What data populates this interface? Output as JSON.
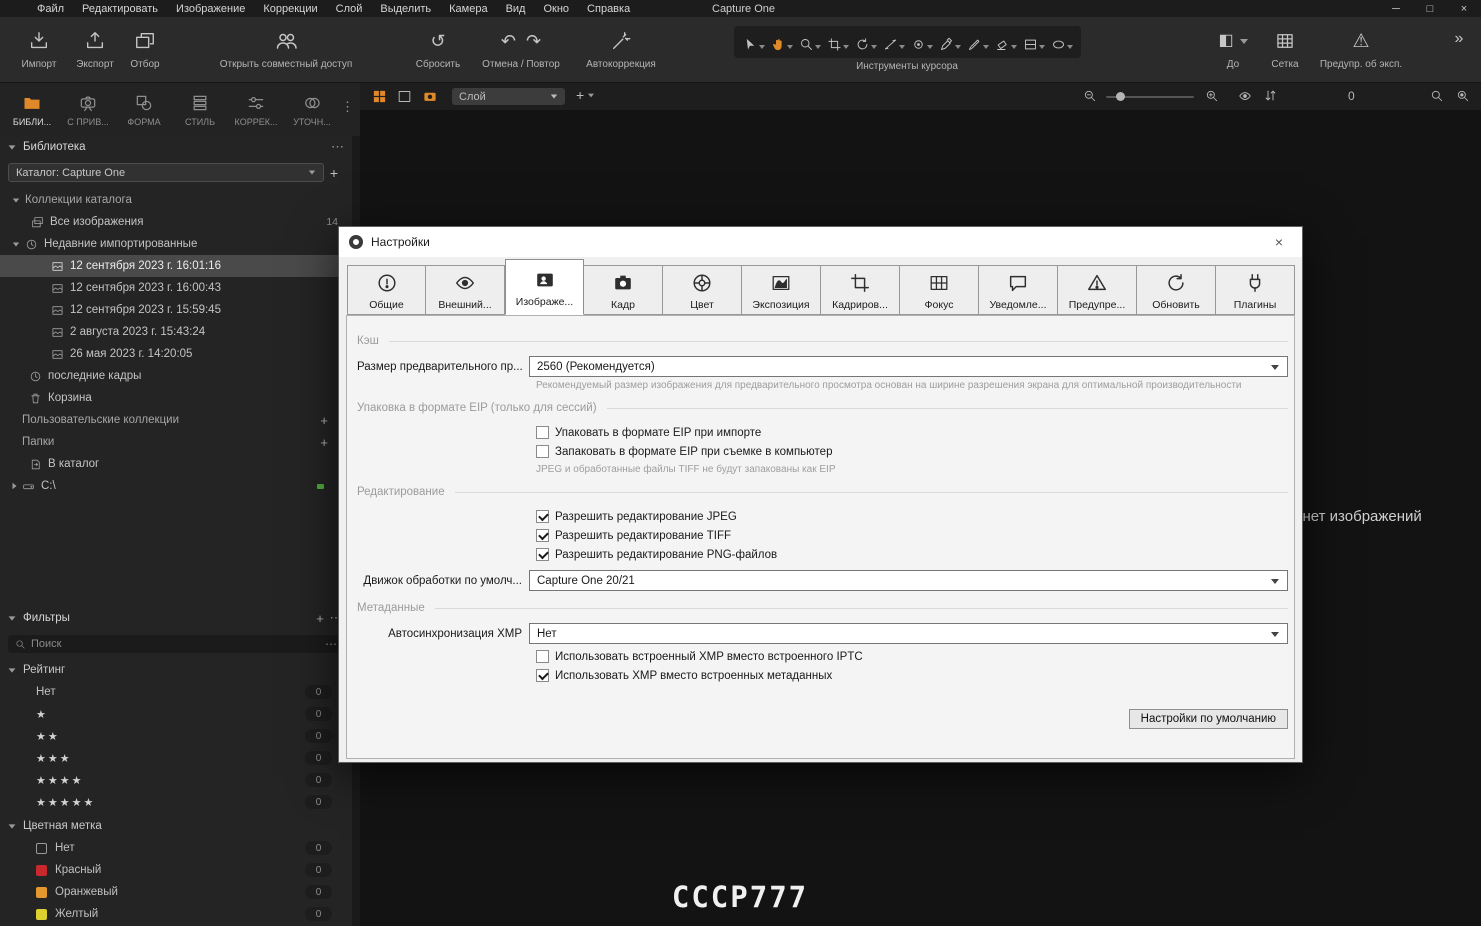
{
  "window": {
    "app_title": "Capture One",
    "controls": {
      "minimize": "─",
      "maximize": "□",
      "close": "×"
    }
  },
  "icons": {
    "plus": "+",
    "more": "⋯",
    "vertical_dots": "⋮",
    "overflow": "»",
    "undo": "↶",
    "redo": "↷",
    "reset": "↺",
    "warning": "⚠",
    "before": "◧"
  },
  "menubar": [
    "Файл",
    "Редактировать",
    "Изображение",
    "Коррекции",
    "Слой",
    "Выделить",
    "Камера",
    "Вид",
    "Окно",
    "Справка"
  ],
  "toolbar": {
    "import_label": "Импорт",
    "export_label": "Экспорт",
    "cull_label": "Отбор",
    "share_label": "Открыть совместный доступ",
    "reset_label": "Сбросить",
    "undo_redo_label": "Отмена / Повтор",
    "autocorrect_label": "Автокоррекция",
    "cursor_tools_label": "Инструменты курсора",
    "before_label": "До",
    "grid_label": "Сетка",
    "exposure_warning_label": "Предупр. об эксп."
  },
  "tool_tabs": [
    {
      "label": "БИБЛИ..."
    },
    {
      "label": "С ПРИВ..."
    },
    {
      "label": "ФОРМА"
    },
    {
      "label": "СТИЛЬ"
    },
    {
      "label": "КОРРЕК..."
    },
    {
      "label": "УТОЧН..."
    }
  ],
  "library": {
    "panel_title": "Библиотека",
    "catalog_selector": "Каталог: Capture One",
    "groups": {
      "catalog_collections": "Коллекции каталога",
      "user_collections": "Пользовательские коллекции",
      "folders": "Папки"
    },
    "items": {
      "all_images": {
        "label": "Все изображения",
        "count": "14"
      },
      "recent_imports": "Недавние импортированные",
      "recent_captures": "последние кадры",
      "trash": "Корзина",
      "in_catalog": "В каталог",
      "drive_c": "C:\\"
    },
    "import_sessions": [
      "12 сентября 2023 г. 16:01:16",
      "12 сентября 2023 г. 16:00:43",
      "12 сентября 2023 г. 15:59:45",
      "2 августа 2023 г. 15:43:24",
      "26 мая 2023 г. 14:20:05"
    ]
  },
  "filters": {
    "panel_title": "Фильтры",
    "search_placeholder": "Поиск",
    "rating_group_label": "Рейтинг",
    "ratings": [
      {
        "label": "Нет",
        "count": "0"
      },
      {
        "label": "★",
        "count": "0"
      },
      {
        "label": "★★",
        "count": "0"
      },
      {
        "label": "★★★",
        "count": "0"
      },
      {
        "label": "★★★★",
        "count": "0"
      },
      {
        "label": "★★★★★",
        "count": "0"
      }
    ],
    "color_group_label": "Цветная метка",
    "color_labels": [
      {
        "label": "Нет",
        "count": "0",
        "swatch": "none"
      },
      {
        "label": "Красный",
        "count": "0",
        "swatch": "#c9282d"
      },
      {
        "label": "Оранжевый",
        "count": "0",
        "swatch": "#e2972f"
      },
      {
        "label": "Желтый",
        "count": "0",
        "swatch": "#ddd12f"
      }
    ]
  },
  "viewer": {
    "layer_selector": "Слой",
    "edit_counter": "0",
    "empty_message": "е нет изображений",
    "photo_plate_text": "СССР777"
  },
  "dialog": {
    "title": "Настройки",
    "tabs": [
      {
        "label": "Общие"
      },
      {
        "label": "Внешний..."
      },
      {
        "label": "Изображе..."
      },
      {
        "label": "Кадр"
      },
      {
        "label": "Цвет"
      },
      {
        "label": "Экспозиция"
      },
      {
        "label": "Кадриров..."
      },
      {
        "label": "Фокус"
      },
      {
        "label": "Уведомле..."
      },
      {
        "label": "Предупре..."
      },
      {
        "label": "Обновить"
      },
      {
        "label": "Плагины"
      }
    ],
    "cache_section": "Кэш",
    "preview_size_label": "Размер предварительного пр...",
    "preview_size_value": "2560 (Рекомендуется)",
    "preview_size_help": "Рекомендуемый размер изображения для предварительного просмотра основан на ширине разрешения экрана для оптимальной производительности",
    "eip_section": "Упаковка в формате EIP (только для сессий)",
    "eip_checkboxes": [
      {
        "label": "Упаковать в формате EIP при импорте",
        "checked": false
      },
      {
        "label": "Запаковать в формате EIP при съемке в компьютер",
        "checked": false
      }
    ],
    "eip_help": "JPEG и обработанные файлы TIFF не будут запакованы как EIP",
    "editing_section": "Редактирование",
    "editing_checkboxes": [
      {
        "label": "Разрешить редактирование JPEG",
        "checked": true
      },
      {
        "label": "Разрешить редактирование TIFF",
        "checked": true
      },
      {
        "label": "Разрешить редактирование PNG-файлов",
        "checked": true
      }
    ],
    "engine_label": "Движок обработки по умолч...",
    "engine_value": "Capture One 20/21",
    "metadata_section": "Метаданные",
    "xmp_sync_label": "Автосинхронизация XMP",
    "xmp_sync_value": "Нет",
    "metadata_checkboxes": [
      {
        "label": "Использовать встроенный XMP вместо встроенного IPTC",
        "checked": false
      },
      {
        "label": "Использовать XMP вместо встроенных метаданных",
        "checked": true
      }
    ],
    "defaults_button": "Настройки по умолчанию"
  }
}
